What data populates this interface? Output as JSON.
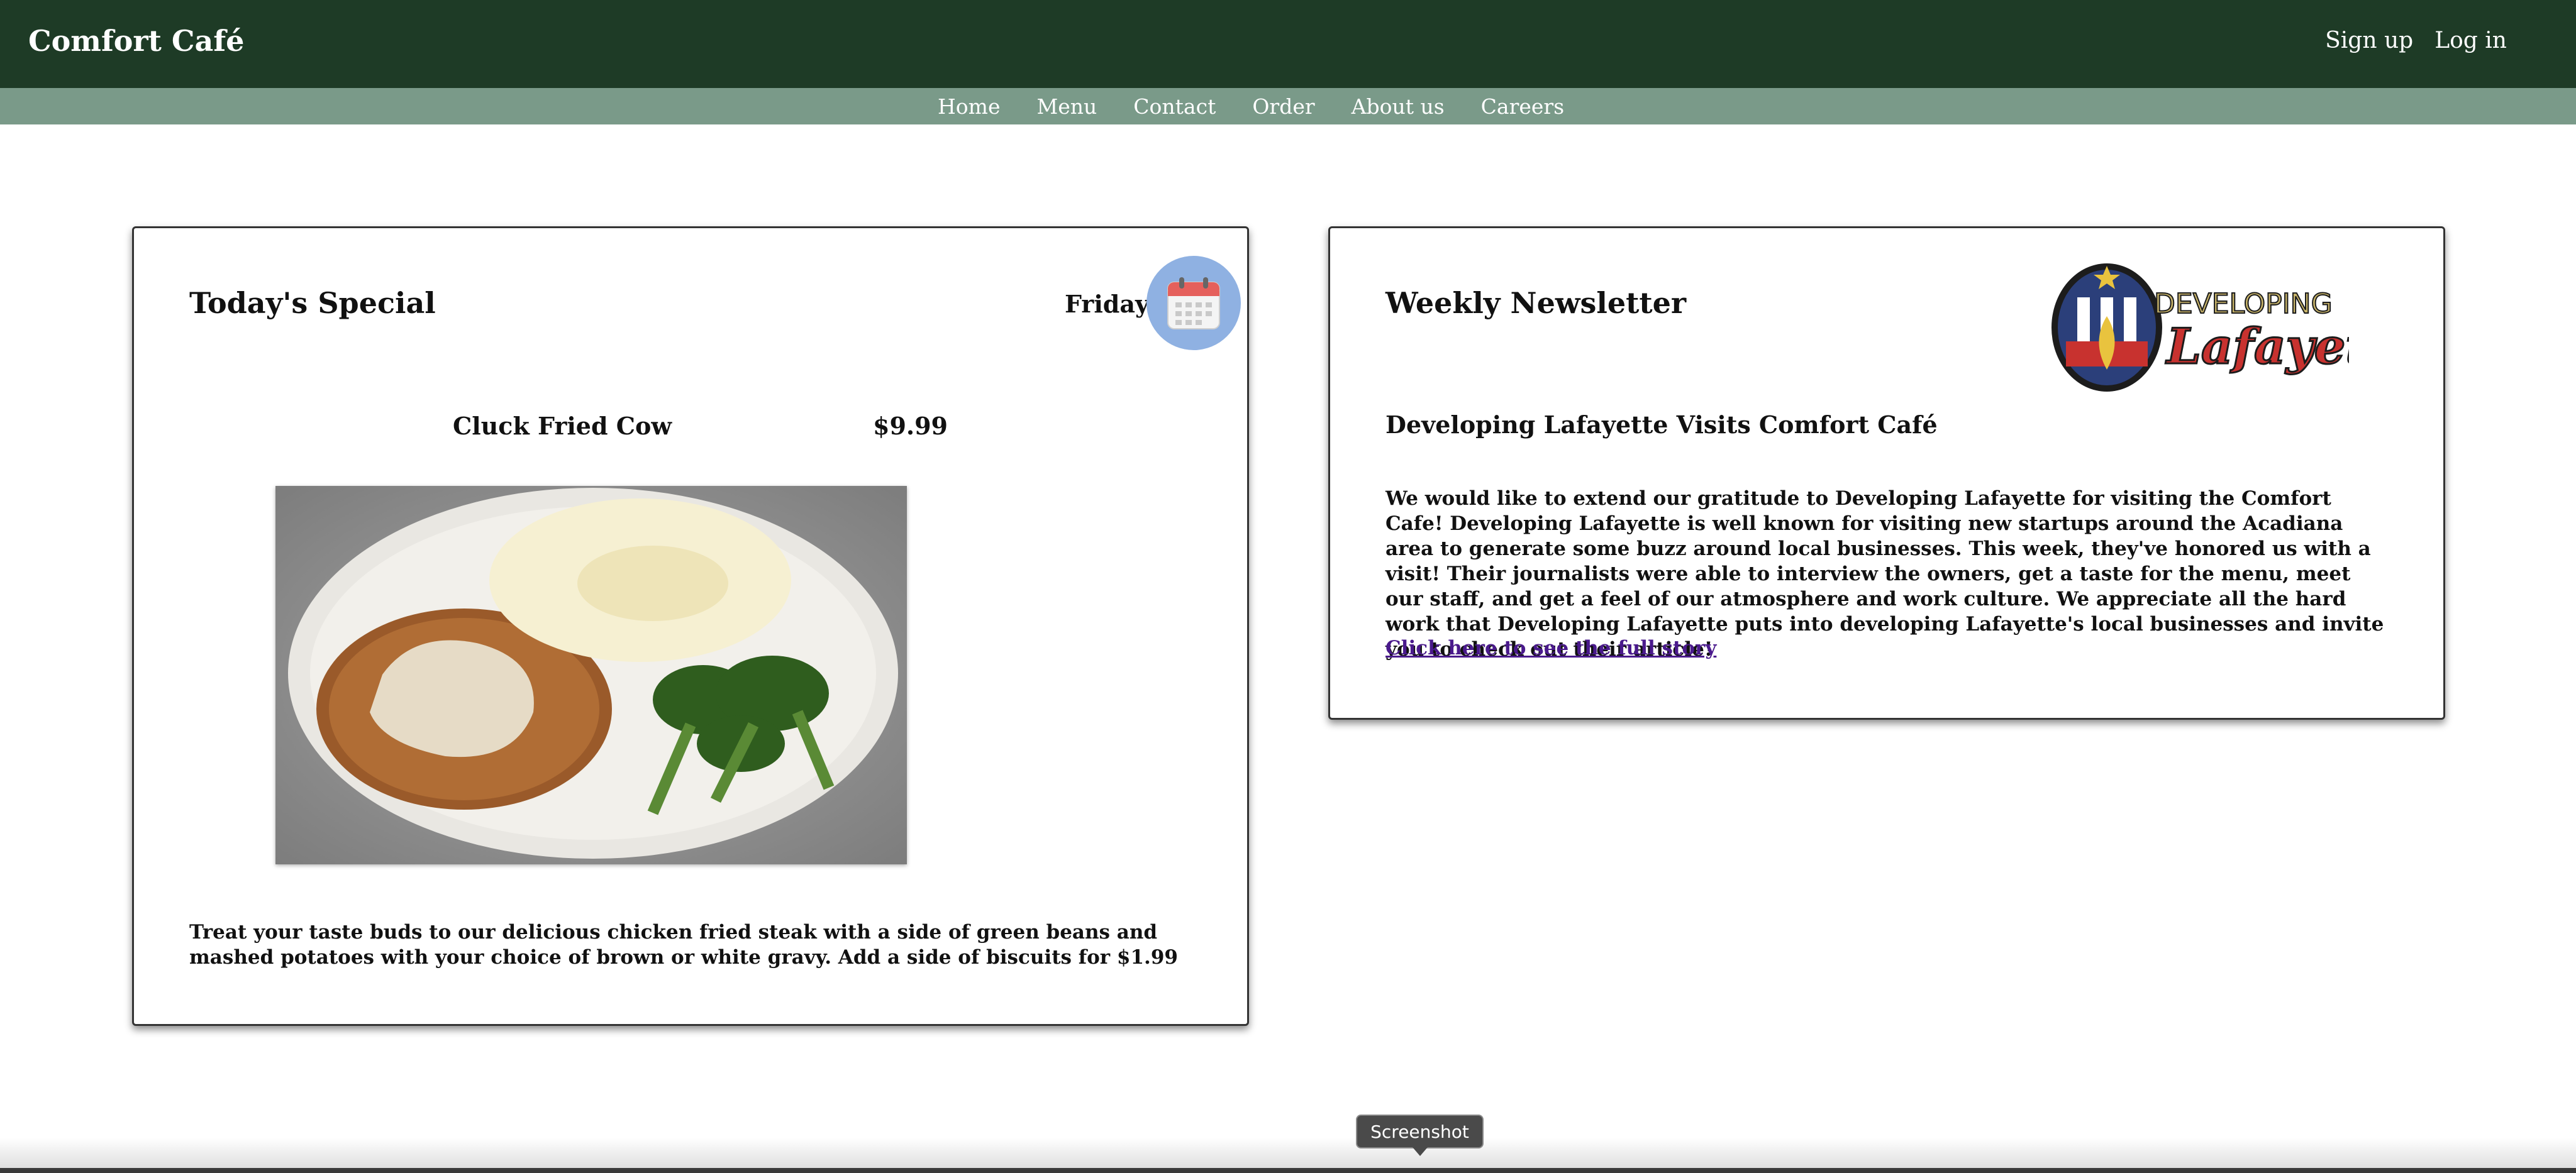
{
  "header": {
    "brand": "Comfort Café",
    "auth": {
      "signup": "Sign up",
      "login": "Log in"
    }
  },
  "nav": {
    "items": [
      {
        "label": "Home"
      },
      {
        "label": "Menu"
      },
      {
        "label": "Contact"
      },
      {
        "label": "Order"
      },
      {
        "label": "About us"
      },
      {
        "label": "Careers"
      }
    ]
  },
  "special": {
    "title": "Today's Special",
    "day": "Friday",
    "dish_name": "Cluck Fried Cow",
    "price": "$9.99",
    "description": "Treat your taste buds to our delicious chicken fried steak with a side of green beans and mashed potatoes with your choice of brown or white gravy. Add a side of biscuits for $1.99"
  },
  "newsletter": {
    "title": "Weekly Newsletter",
    "logo_text_top": "DEVELOPING",
    "logo_text_bottom": "Lafayette",
    "headline": "Developing Lafayette Visits Comfort Café",
    "body": "We would like to extend our gratitude to Developing Lafayette for visiting the Comfort Cafe! Developing Lafayette is well known for visiting new startups around the Acadiana area to generate some buzz around local businesses. This week, they've honored us with a visit! Their journalists were able to interview the owners, get a taste for the menu, meet our staff, and get a feel of our atmosphere and work culture. We appreciate all the hard work that Developing Lafayette puts into developing Lafayette's local businesses and invite you to check out their article!",
    "link": "Click here to see the full story"
  },
  "tooltip": "Screenshot",
  "colors": {
    "header_bg": "#1e3b26",
    "nav_bg": "#7a9a89",
    "link": "#4a1a8c",
    "calendar_badge": "#8fb1e2"
  },
  "icons": {
    "calendar": "calendar-icon",
    "logo": "developing-lafayette-logo"
  }
}
